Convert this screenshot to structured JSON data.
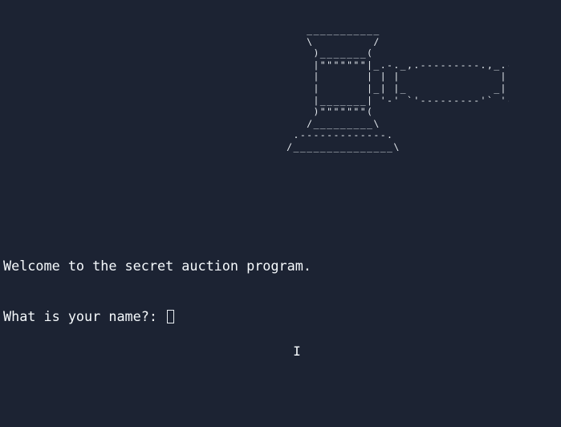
{
  "terminal": {
    "background": "#1c2333",
    "foreground": "#f5f9fc",
    "ascii_art": "                   ___________\n                   \\         /\n                    )_______(\n                    |\"\"\"\"\"\"\"|_.-._,.---------.,_.-._\n                    |       | | |               | | ''-.\n                    |       |_| |_             _| |_..-'\n                    |_______| '-' `'---------'` '-'\n                    )\"\"\"\"\"\"\"(\n                   /_________\\\n                 .-------------.\n                /_______________\\",
    "welcome_line": "Welcome to the secret auction program.",
    "prompt_line": "What is your name?: ",
    "input_value": "",
    "mouse_cursor_icon": "i-beam-cursor-icon"
  }
}
